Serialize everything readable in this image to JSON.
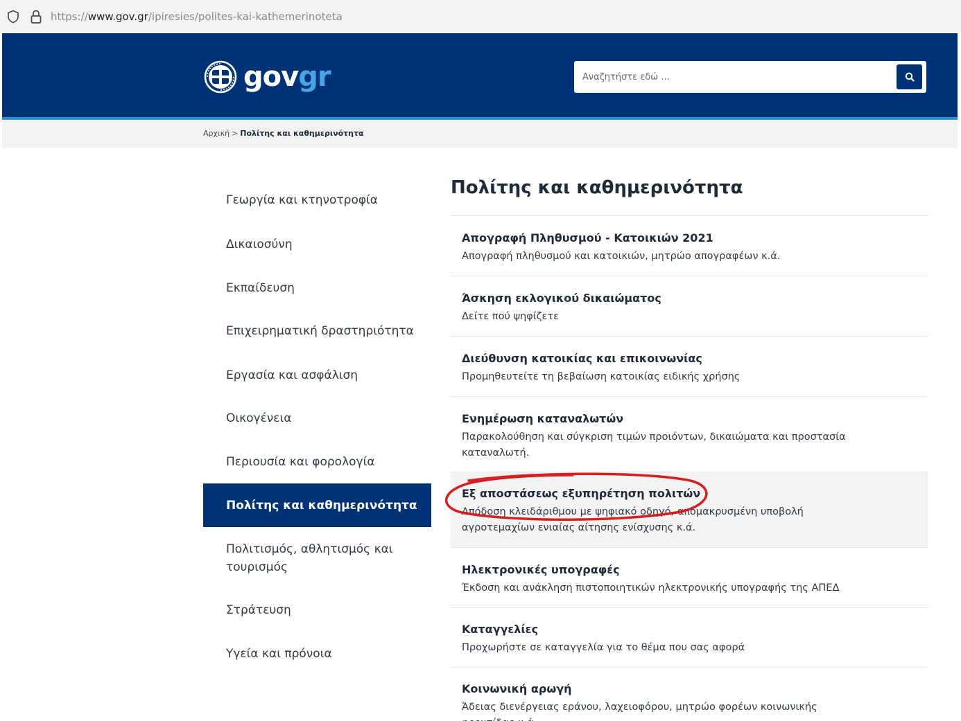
{
  "browser": {
    "url_scheme": "https://",
    "url_host": "www.gov.gr",
    "url_path": "/ipiresies/polites-kai-kathemerinoteta"
  },
  "header": {
    "logo": {
      "gov": "gov",
      "gr": "gr"
    },
    "search": {
      "placeholder": "Αναζητήστε εδώ ..."
    },
    "colors": {
      "brand": "#003375",
      "accent": "#2f8fd0",
      "logo_gr": "#4aa3e6"
    }
  },
  "breadcrumb": {
    "home": "Αρχική",
    "separator": ">",
    "current": "Πολίτης και καθημερινότητα"
  },
  "sidebar": {
    "items": [
      {
        "label": "Γεωργία και κτηνοτροφία"
      },
      {
        "label": "Δικαιοσύνη"
      },
      {
        "label": "Εκπαίδευση"
      },
      {
        "label": "Επιχειρηματική δραστηριότητα"
      },
      {
        "label": "Εργασία και ασφάλιση"
      },
      {
        "label": "Οικογένεια"
      },
      {
        "label": "Περιουσία και φορολογία"
      },
      {
        "label": "Πολίτης και καθημερινότητα",
        "active": true
      },
      {
        "label": "Πολιτισμός, αθλητισμός και τουρισμός"
      },
      {
        "label": "Στράτευση"
      },
      {
        "label": "Υγεία και πρόνοια"
      }
    ]
  },
  "main": {
    "title": "Πολίτης και καθημερινότητα",
    "services": [
      {
        "title": "Απογραφή Πληθυσμού - Κατοικιών 2021",
        "desc": "Απογραφή πληθυσμού και κατοικιών, μητρώο απογραφέων κ.ά."
      },
      {
        "title": "Άσκηση εκλογικού δικαιώματος",
        "desc": "Δείτε πού ψηφίζετε"
      },
      {
        "title": "Διεύθυνση κατοικίας και επικοινωνίας",
        "desc": "Προμηθευτείτε τη βεβαίωση κατοικίας ειδικής χρήσης"
      },
      {
        "title": "Ενημέρωση καταναλωτών",
        "desc": "Παρακολούθηση και σύγκριση τιμών προιόντων, δικαιώματα και προστασία καταναλωτή."
      },
      {
        "title": "Εξ αποστάσεως εξυπηρέτηση πολιτών",
        "desc": "Απόδοση κλειδάριθμου με ψηφιακό οδηγό, απομακρυσμένη υποβολή αγροτεμαχίων ενιαίας αίτησης ενίσχυσης κ.ά.",
        "highlighted": true
      },
      {
        "title": "Ηλεκτρονικές υπογραφές",
        "desc": "Έκδοση και ανάκληση πιστοποιητικών ηλεκτρονικής υπογραφής της ΑΠΕΔ"
      },
      {
        "title": "Καταγγελίες",
        "desc": "Προχωρήστε σε καταγγελία για το θέμα που σας αφορά"
      },
      {
        "title": "Κοινωνική αρωγή",
        "desc": "Άδειας διενέργειας εράνου, λαχειοφόρου, μητρώο φορέων κοινωνικής φροντίδας κ.ά."
      }
    ]
  },
  "annotation": {
    "color": "#d42020",
    "shape": "hand-drawn ellipse"
  }
}
